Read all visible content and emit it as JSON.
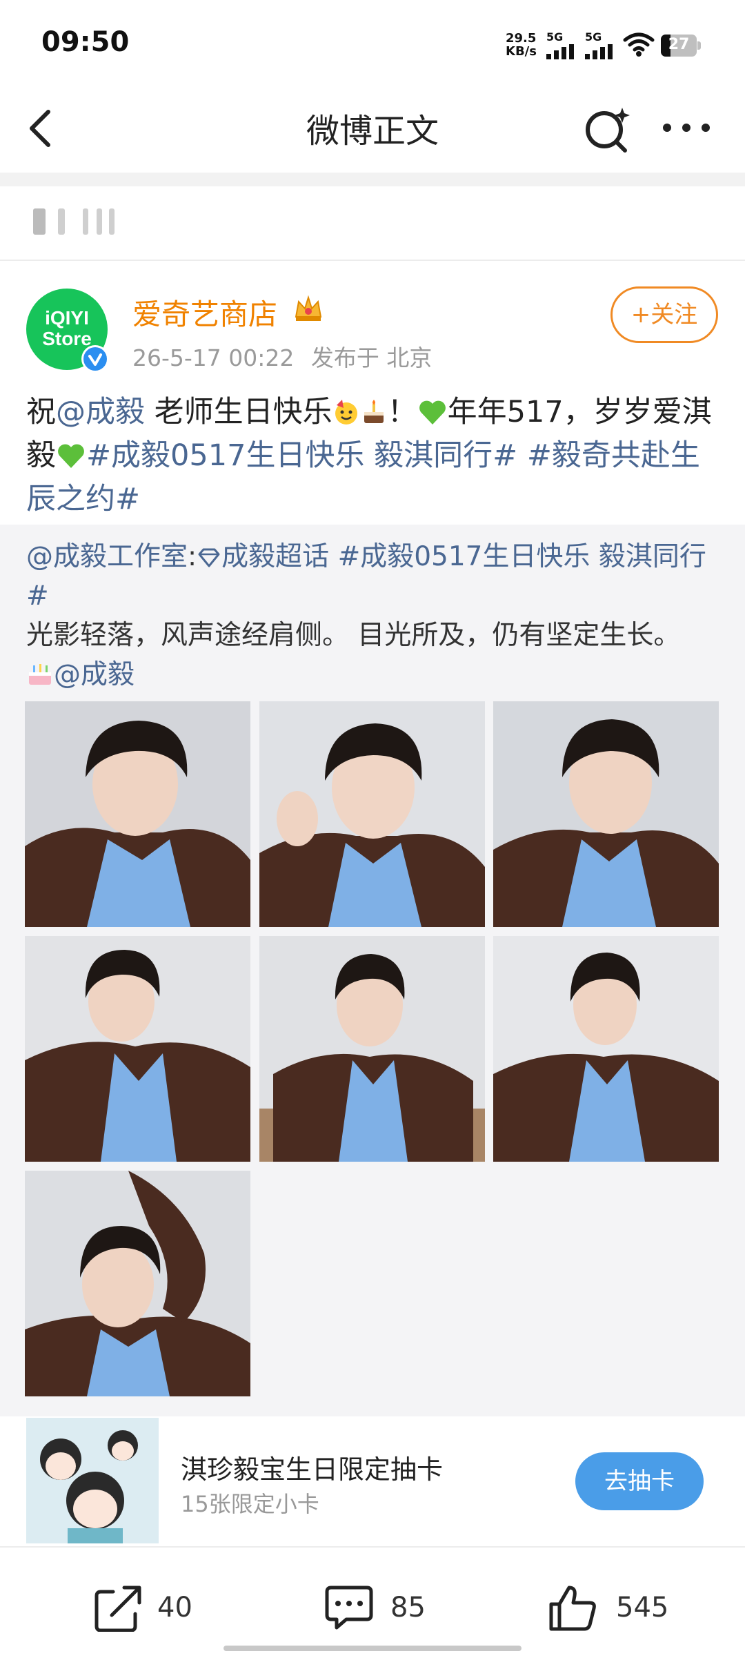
{
  "status_bar": {
    "time": "09:50",
    "net_speed_value": "29.5",
    "net_speed_unit": "KB/s",
    "signal_1_label": "5G",
    "signal_2_label": "5G",
    "battery": "27"
  },
  "header": {
    "title": "微博正文"
  },
  "post": {
    "author": "爱奇艺商店",
    "avatar_text_line1": "iQIYI",
    "avatar_text_line2": "Store",
    "time": "26-5-17 00:22",
    "location": "发布于 北京",
    "follow_label": "+关注",
    "text": {
      "p1": "祝",
      "mention_1": "@成毅",
      "p2": " 老师生日快乐",
      "p3": "！",
      "p4": "年年517，岁岁爱淇毅",
      "topic_1": "#成毅0517生日快乐 毅淇同行#",
      "topic_2": " #毅奇共赴生辰之约#"
    }
  },
  "repost": {
    "mention_studio": "@成毅工作室",
    "colon": ":",
    "supertopic": "成毅超话",
    "topic": " #成毅0517生日快乐 毅淇同行#",
    "body": "光影轻落，风声途经肩侧。 目光所及，仍有坚定生长。",
    "mention_end": "@成毅",
    "photo_count": 7
  },
  "card": {
    "title": "淇珍毅宝生日限定抽卡",
    "subtitle": "15张限定小卡",
    "button_label": "去抽卡"
  },
  "actions": {
    "repost_count": "40",
    "comment_count": "85",
    "like_count": "545"
  },
  "colors": {
    "accent_orange": "#f08200",
    "link_blue": "#4a6792",
    "button_blue": "#4a9de8",
    "avatar_green": "#17c45a"
  }
}
